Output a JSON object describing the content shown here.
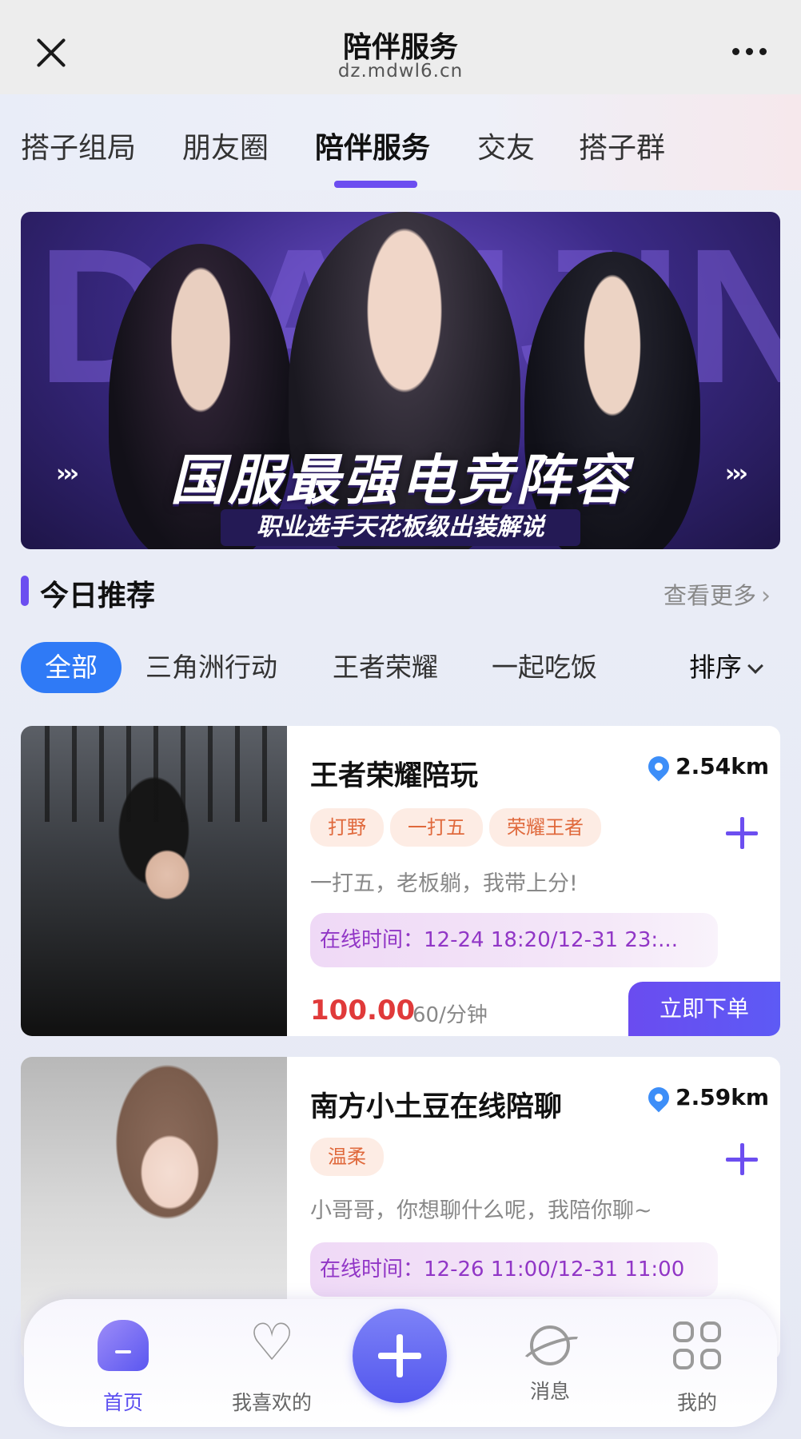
{
  "header": {
    "title": "陪伴服务",
    "domain": "dz.mdwl6.cn"
  },
  "tabs": [
    {
      "label": "搭子组局"
    },
    {
      "label": "朋友圈"
    },
    {
      "label": "陪伴服务",
      "active": true
    },
    {
      "label": "交友"
    },
    {
      "label": "搭子群"
    }
  ],
  "banner": {
    "bg_text": "DIANJING",
    "headline": "国服最强电竞阵容",
    "subtitle": "职业选手天花板级出装解说",
    "chevrons": "›››",
    "slide_count": 2,
    "active_slide": 1
  },
  "recommend": {
    "title": "今日推荐",
    "see_more": "查看更多",
    "chev": "›"
  },
  "filters": {
    "chips": [
      "全部",
      "三角洲行动",
      "王者荣耀",
      "一起吃饭"
    ],
    "active_index": 0,
    "sort_label": "排序"
  },
  "cards": [
    {
      "title": "王者荣耀陪玩",
      "distance": "2.54km",
      "tags": [
        "打野",
        "一打五",
        "荣耀王者"
      ],
      "desc": "一打五，老板躺，我带上分!",
      "online": "在线时间：12-24 18:20/12-31 23:...",
      "price": "100.00",
      "unit": "60/分钟",
      "order_label": "立即下单"
    },
    {
      "title": "南方小土豆在线陪聊",
      "distance": "2.59km",
      "tags": [
        "温柔"
      ],
      "desc": "小哥哥，你想聊什么呢，我陪你聊~",
      "online": "在线时间：12-26 11:00/12-31 11:00"
    }
  ],
  "bottom_nav": {
    "items": [
      {
        "label": "首页",
        "icon": "home-icon",
        "active": true
      },
      {
        "label": "我喜欢的",
        "icon": "heart-icon"
      },
      {
        "label": "消息",
        "icon": "planet-icon"
      },
      {
        "label": "我的",
        "icon": "grid-icon"
      }
    ]
  },
  "colors": {
    "accent": "#6c4ef0",
    "chip_active": "#2f7af6",
    "price": "#e03a3a",
    "tag_text": "#e0693c",
    "online_text": "#9136c6"
  }
}
